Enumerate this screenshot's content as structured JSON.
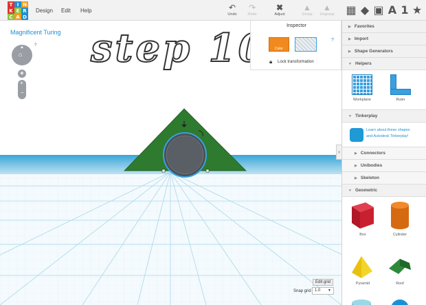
{
  "logo": {
    "letters": [
      "T",
      "I",
      "N",
      "K",
      "E",
      "R",
      "C",
      "A",
      "D"
    ],
    "colors": [
      "#e0322b",
      "#1e8fd1",
      "#f39c1f",
      "#e0322b",
      "#8ec43e",
      "#1e8fd1",
      "#8ec43e",
      "#f39c1f",
      "#1e8fd1"
    ]
  },
  "menu": {
    "design": "Design",
    "edit": "Edit",
    "help": "Help"
  },
  "toolbar": {
    "undo": "Undo",
    "redo": "Redo",
    "adjust": "Adjust",
    "group": "Group",
    "ungroup": "Ungroup"
  },
  "views": {
    "text_tool": "A",
    "number_tool": "1",
    "star": "★"
  },
  "project": {
    "name": "Magnificent Turing",
    "help": "?"
  },
  "overlay": {
    "step_text": "step 10"
  },
  "inspector": {
    "title": "Inspector",
    "color_label": "Color",
    "lock_label": "Lock transformation",
    "help": "?"
  },
  "grid": {
    "edit_grid": "Edit grid",
    "snap_label": "Snap grid",
    "snap_value": "1.0"
  },
  "sidebar": {
    "favorites": "Favorites",
    "import": "Import",
    "shape_generators": "Shape Generators",
    "helpers": "Helpers",
    "workplane": "Workplane",
    "ruler": "Ruler",
    "tinkerplay": "Tinkerplay",
    "tinkerplay_text": "Learn about these shapes and Autodesk Tinkerplay!",
    "connectors": "Connectors",
    "unibodies": "Unibodies",
    "skeleton": "Skeleton",
    "geometric": "Geometric",
    "box": "Box",
    "cylinder": "Cylinder",
    "pyramid": "Pyramid",
    "roof": "Roof"
  },
  "colors": {
    "brand_blue": "#1e8fd1",
    "shape_green": "#2e7a2e",
    "color_swatch": "#f08a1e",
    "selection": "#3aa0e0"
  }
}
